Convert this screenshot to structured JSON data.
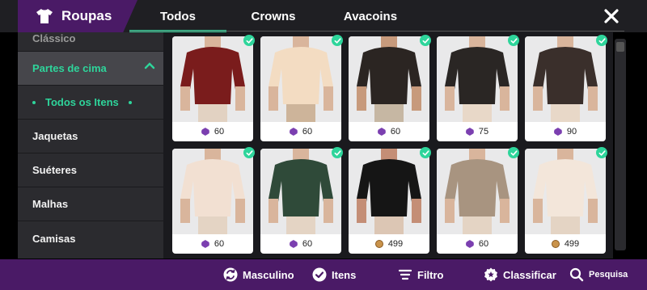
{
  "app": {
    "title": "Roupas"
  },
  "tabs": [
    {
      "label": "Todos",
      "active": true
    },
    {
      "label": "Crowns",
      "active": false
    },
    {
      "label": "Avacoins",
      "active": false
    }
  ],
  "sidebar": {
    "cut_item": "Clássico",
    "open_category": "Partes de cima",
    "sub_item": "Todos os Itens",
    "items": [
      "Jaquetas",
      "Suéteres",
      "Malhas",
      "Camisas"
    ]
  },
  "grid": [
    {
      "price": "60",
      "currency": "crown-icon",
      "shirt": "#7a1c1c",
      "skin": "#d9b59c",
      "pants": "#e2d2c2"
    },
    {
      "price": "60",
      "currency": "crown-icon",
      "shirt": "#f3dcc2",
      "skin": "#d9b59c",
      "pants": "#cdb49a"
    },
    {
      "price": "60",
      "currency": "crown-icon",
      "shirt": "#2b2522",
      "skin": "#c79a7c",
      "pants": "#c6b7a3"
    },
    {
      "price": "75",
      "currency": "crown-icon",
      "shirt": "#2a2624",
      "skin": "#d9b59c",
      "pants": "#e8d8c8"
    },
    {
      "price": "90",
      "currency": "crown-icon",
      "shirt": "#3a2f2b",
      "skin": "#d9b59c",
      "pants": "#e8d8c8"
    },
    {
      "price": "60",
      "currency": "crown-icon",
      "shirt": "#f2e0d2",
      "skin": "#d9b59c",
      "pants": "#e4d4c4"
    },
    {
      "price": "60",
      "currency": "crown-icon",
      "shirt": "#2f4a39",
      "skin": "#d9b59c",
      "pants": "#e4d4c4"
    },
    {
      "price": "499",
      "currency": "avacoin-icon",
      "shirt": "#151515",
      "skin": "#c48e76",
      "pants": "#dcc6b4"
    },
    {
      "price": "60",
      "currency": "crown-icon",
      "shirt": "#a89480",
      "skin": "#d9b59c",
      "pants": "#e4d4c4"
    },
    {
      "price": "499",
      "currency": "avacoin-icon",
      "shirt": "#f3e6da",
      "skin": "#d9b59c",
      "pants": "#e4d4c4"
    }
  ],
  "bottom_bar": {
    "gender": "Masculino",
    "items": "Itens",
    "filter": "Filtro",
    "sort": "Classificar",
    "search": "Pesquisa"
  },
  "colors": {
    "accent": "#2ed59b",
    "brand": "#4a1a66",
    "panel": "#2b2b2f"
  }
}
